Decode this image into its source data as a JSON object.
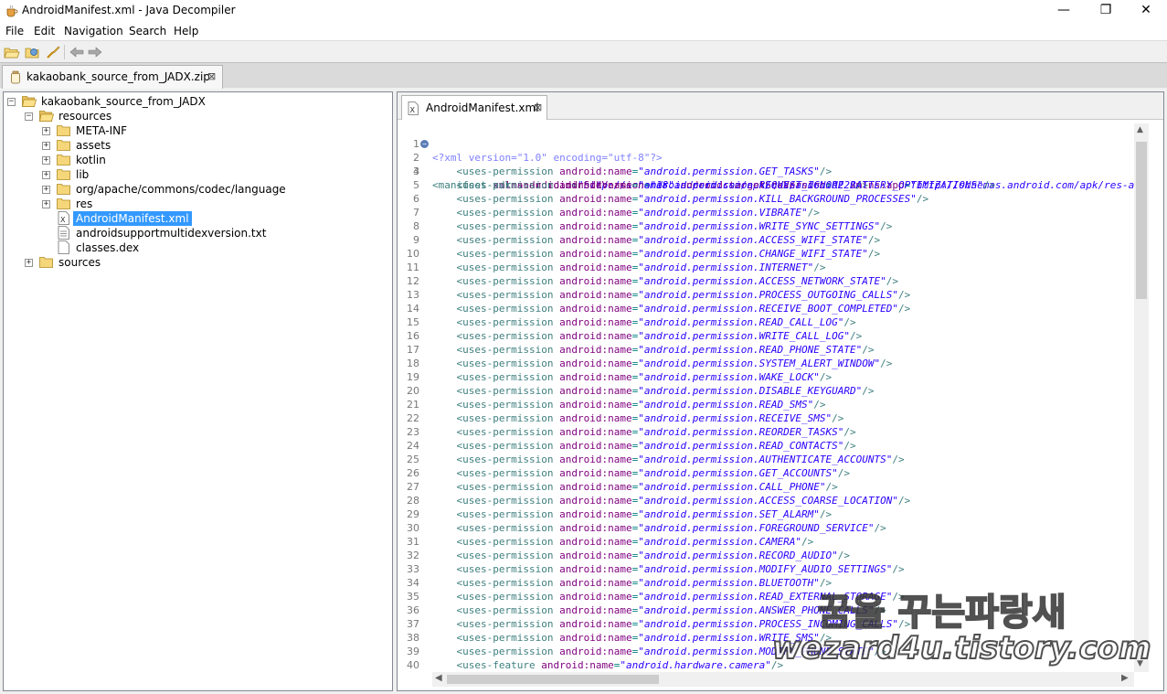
{
  "window": {
    "title": "AndroidManifest.xml - Java Decompiler",
    "minimize": "—",
    "maximize": "❐",
    "close": "✕"
  },
  "menu": [
    "File",
    "Edit",
    "Navigation",
    "Search",
    "Help"
  ],
  "toolbar": {
    "icons": [
      "open-file-icon",
      "open-type-icon",
      "search-icon",
      "back-icon",
      "forward-icon"
    ]
  },
  "file_tab": {
    "label": "kakaobank_source_from_JADX.zip",
    "close": "⊠"
  },
  "tree": {
    "root": "kakaobank_source_from_JADX",
    "resources": "resources",
    "meta_inf": "META-INF",
    "assets": "assets",
    "kotlin": "kotlin",
    "lib": "lib",
    "org_apache": "org/apache/commons/codec/language",
    "res": "res",
    "android_manifest": "AndroidManifest.xml",
    "androidsupport": "androidsupportmultidexversion.txt",
    "classes_dex": "classes.dex",
    "sources": "sources"
  },
  "editor": {
    "tab_label": "AndroidManifest.xml",
    "tab_close": "⊠",
    "xml_decl": "<?xml version=\"1.0\" encoding=\"utf-8\"?>",
    "manifest_line": {
      "tag": "<manifest ",
      "a1": "xmlns:android",
      "v1": "\"http://schemas.android.com/apk/res/android\"",
      "a2": "xmlns:app",
      "v2": "\"http://schemas.android.com/apk/res-auto\""
    },
    "sdk_line": {
      "tag": "<uses-sdk ",
      "a1": "android:minSdkVersion",
      "v1": "\"18\"",
      "a2": "android:targetSdkVersion",
      "v2": "\"22\""
    },
    "permission_tag": "<uses-permission ",
    "name_attr": "android:name",
    "permissions": [
      "\"android.permission.GET_TASKS\"",
      "\"android.permission.REQUEST_IGNORE_BATTERY_OPTIMIZATIONS\"",
      "\"android.permission.KILL_BACKGROUND_PROCESSES\"",
      "\"android.permission.VIBRATE\"",
      "\"android.permission.WRITE_SYNC_SETTINGS\"",
      "\"android.permission.ACCESS_WIFI_STATE\"",
      "\"android.permission.CHANGE_WIFI_STATE\"",
      "\"android.permission.INTERNET\"",
      "\"android.permission.ACCESS_NETWORK_STATE\"",
      "\"android.permission.PROCESS_OUTGOING_CALLS\"",
      "\"android.permission.RECEIVE_BOOT_COMPLETED\"",
      "\"android.permission.READ_CALL_LOG\"",
      "\"android.permission.WRITE_CALL_LOG\"",
      "\"android.permission.READ_PHONE_STATE\"",
      "\"android.permission.SYSTEM_ALERT_WINDOW\"",
      "\"android.permission.WAKE_LOCK\"",
      "\"android.permission.DISABLE_KEYGUARD\"",
      "\"android.permission.READ_SMS\"",
      "\"android.permission.RECEIVE_SMS\"",
      "\"android.permission.REORDER_TASKS\"",
      "\"android.permission.READ_CONTACTS\"",
      "\"android.permission.AUTHENTICATE_ACCOUNTS\"",
      "\"android.permission.GET_ACCOUNTS\"",
      "\"android.permission.CALL_PHONE\"",
      "\"android.permission.ACCESS_COARSE_LOCATION\"",
      "\"android.permission.SET_ALARM\"",
      "\"android.permission.FOREGROUND_SERVICE\"",
      "\"android.permission.CAMERA\"",
      "\"android.permission.RECORD_AUDIO\"",
      "\"android.permission.MODIFY_AUDIO_SETTINGS\"",
      "\"android.permission.BLUETOOTH\"",
      "\"android.permission.READ_EXTERNAL_STORAGE\"",
      "\"android.permission.ANSWER_PHONE_CALLS\"",
      "\"android.permission.PROCESS_INCOMING_CALLS\"",
      "\"android.permission.WRITE_SMS\"",
      "\"android.permission.MODIFY_PHONE_STATE\""
    ],
    "feature_line": {
      "tag": "<uses-feature ",
      "a1": "android:name",
      "v1": "\"android.hardware.camera\""
    },
    "close_empty": "/>",
    "close_open": ">",
    "eq": "="
  },
  "watermark": {
    "line1": "꿈을 꾸는파랑새",
    "line2": "wezard4u.tistory.com"
  },
  "colors": {
    "tag": "#3f7f7f",
    "attr": "#7f007f",
    "value": "#2a00ff",
    "selection": "#3399ff"
  }
}
